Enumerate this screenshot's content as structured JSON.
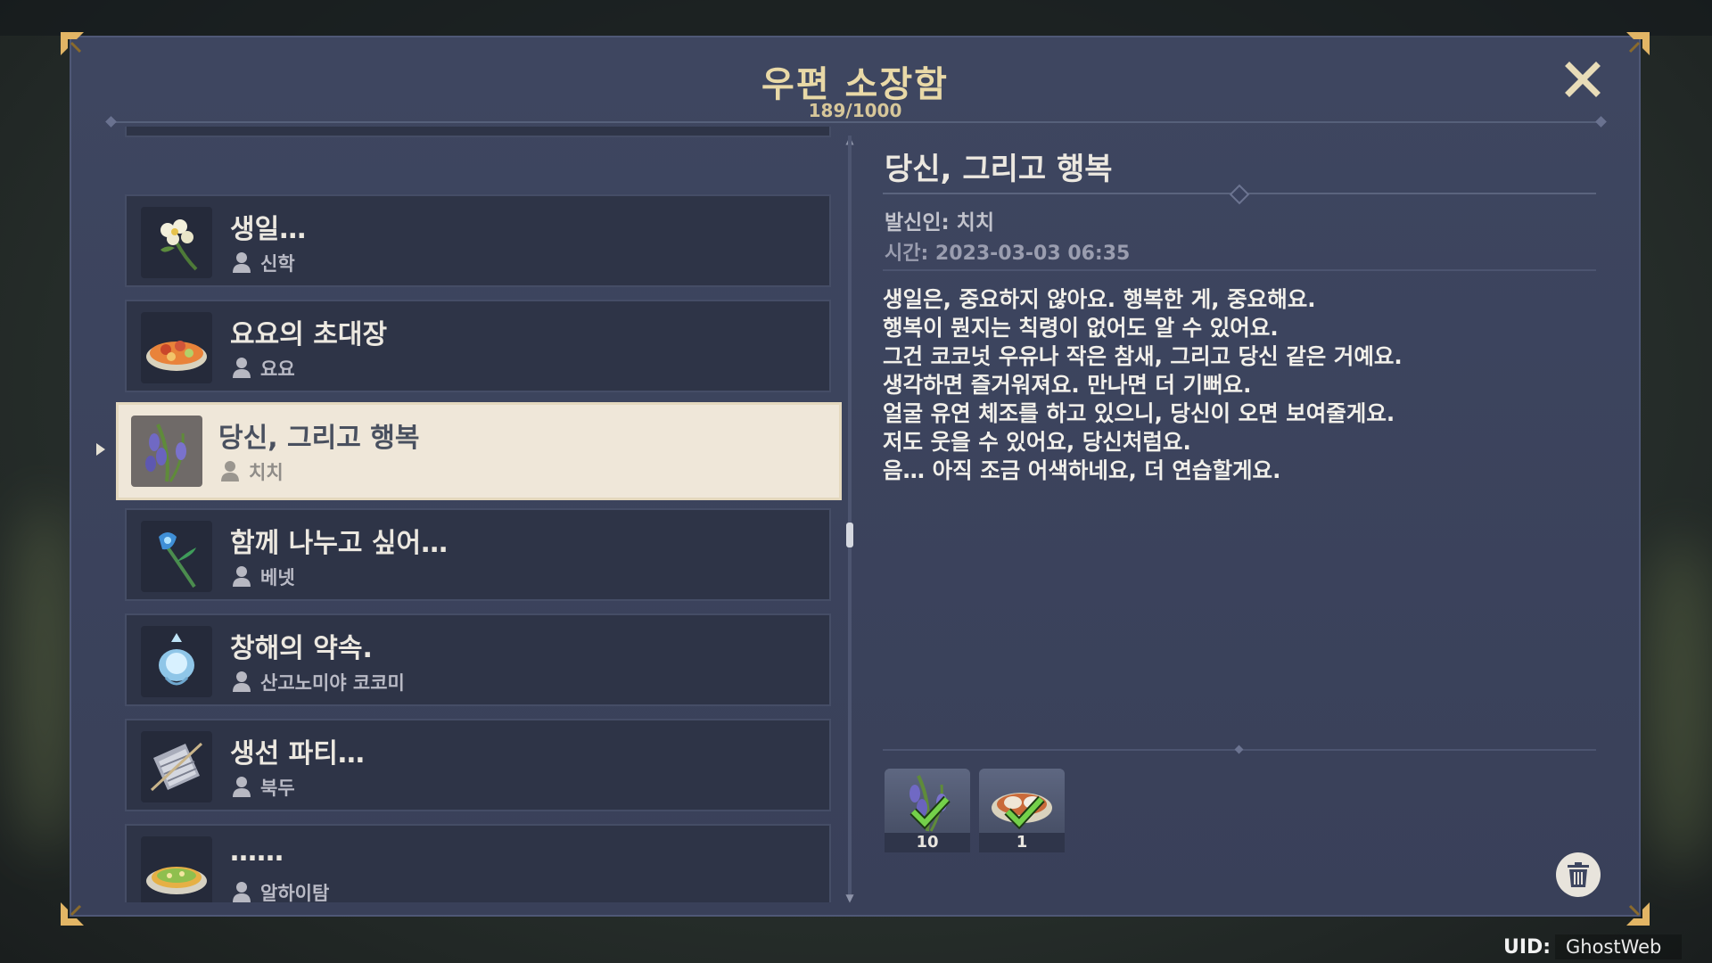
{
  "header": {
    "title": "우편 소장함",
    "count": "189/1000"
  },
  "mail_list": [
    {
      "title": "생일…",
      "sender": "신학",
      "icon": "white-flower-icon"
    },
    {
      "title": "요요의 초대장",
      "sender": "요요",
      "icon": "dish-icon"
    },
    {
      "title": "당신, 그리고 행복",
      "sender": "치치",
      "icon": "violetgrass-icon",
      "selected": true
    },
    {
      "title": "함께 나누고 싶어…",
      "sender": "베넷",
      "icon": "blue-flower-icon"
    },
    {
      "title": "창해의 약속.",
      "sender": "산고노미야 코코미",
      "icon": "sea-ganoderma-icon"
    },
    {
      "title": "생선 파티…",
      "sender": "북두",
      "icon": "fish-skewer-icon"
    },
    {
      "title": "……",
      "sender": "알하이탐",
      "icon": "pizza-icon"
    }
  ],
  "detail": {
    "title": "당신, 그리고 행복",
    "from": "발신인: 치치",
    "time": "시간: 2023-03-03 06:35",
    "body": [
      "생일은, 중요하지 않아요. 행복한 게, 중요해요.",
      "행복이 뭔지는 칙령이 없어도 알 수 있어요.",
      "그건 코코넛 우유나 작은 참새, 그리고 당신 같은 거예요.",
      "생각하면 즐거워져요. 만나면 더 기뻐요.",
      "얼굴 유연 체조를 하고 있으니, 당신이 오면 보여줄게요.",
      "저도 웃을 수 있어요, 당신처럼요.",
      "음… 아직 조금 어색하네요, 더 연습할게요."
    ],
    "attachments": [
      {
        "count": "10",
        "icon": "violetgrass-icon",
        "claimed": true
      },
      {
        "count": "1",
        "icon": "dish-icon",
        "claimed": true
      }
    ]
  },
  "footer": {
    "uid_label": "UID:",
    "uid_value": "GhostWeb"
  },
  "colors": {
    "title_gold": "#e9d9a7",
    "panel": "#394059",
    "selected_item": "#efe7d9",
    "check_green": "#74d14a"
  }
}
